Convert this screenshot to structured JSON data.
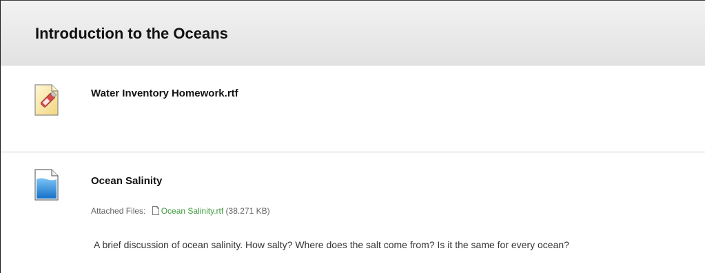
{
  "header": {
    "title": "Introduction to the Oceans"
  },
  "items": [
    {
      "title": "Water Inventory Homework.rtf",
      "icon": "usb-drive-file-icon"
    },
    {
      "title": "Ocean Salinity",
      "icon": "blue-document-icon",
      "attached_label": "Attached Files:",
      "attached_file": "Ocean Salinity.rtf",
      "attached_size": "(38.271 KB)",
      "description": "A brief discussion of ocean salinity. How salty? Where does the salt come from? Is it the same for every ocean?"
    }
  ],
  "colors": {
    "header_bg": "#e9e9e9",
    "link_green": "#3c9a3c",
    "divider": "#cccccc"
  }
}
